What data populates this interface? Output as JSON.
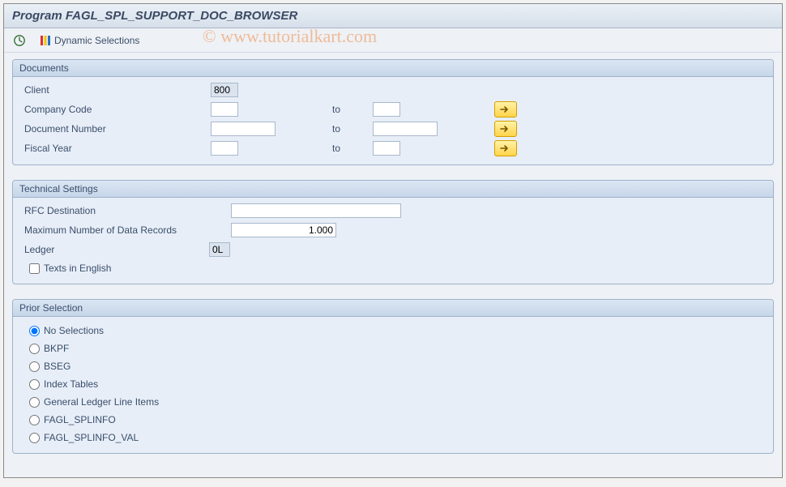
{
  "title": "Program FAGL_SPL_SUPPORT_DOC_BROWSER",
  "toolbar": {
    "execute_tooltip": "Execute",
    "dynsel_label": "Dynamic Selections"
  },
  "watermark": "© www.tutorialkart.com",
  "documents": {
    "header": "Documents",
    "rows": [
      {
        "label": "Client",
        "from": "800",
        "readonly": true,
        "to_label": "",
        "to": "",
        "more": false,
        "w1": 34,
        "w2": 0
      },
      {
        "label": "Company Code",
        "from": "",
        "readonly": false,
        "to_label": "to",
        "to": "",
        "more": true,
        "w1": 34,
        "w2": 34
      },
      {
        "label": "Document Number",
        "from": "",
        "readonly": false,
        "to_label": "to",
        "to": "",
        "more": true,
        "w1": 80,
        "w2": 80
      },
      {
        "label": "Fiscal Year",
        "from": "",
        "readonly": false,
        "to_label": "to",
        "to": "",
        "more": true,
        "w1": 34,
        "w2": 34
      }
    ]
  },
  "tech": {
    "header": "Technical Settings",
    "rfc_label": "RFC Destination",
    "rfc_value": "",
    "max_label": "Maximum Number of Data Records",
    "max_value": "1.000",
    "ledger_label": "Ledger",
    "ledger_value": "0L",
    "texts_label": "Texts in English",
    "texts_checked": false
  },
  "prior": {
    "header": "Prior Selection",
    "options": [
      {
        "label": "No Selections",
        "checked": true
      },
      {
        "label": "BKPF",
        "checked": false
      },
      {
        "label": "BSEG",
        "checked": false
      },
      {
        "label": "Index Tables",
        "checked": false
      },
      {
        "label": "General Ledger Line Items",
        "checked": false
      },
      {
        "label": "FAGL_SPLINFO",
        "checked": false
      },
      {
        "label": "FAGL_SPLINFO_VAL",
        "checked": false
      }
    ]
  }
}
